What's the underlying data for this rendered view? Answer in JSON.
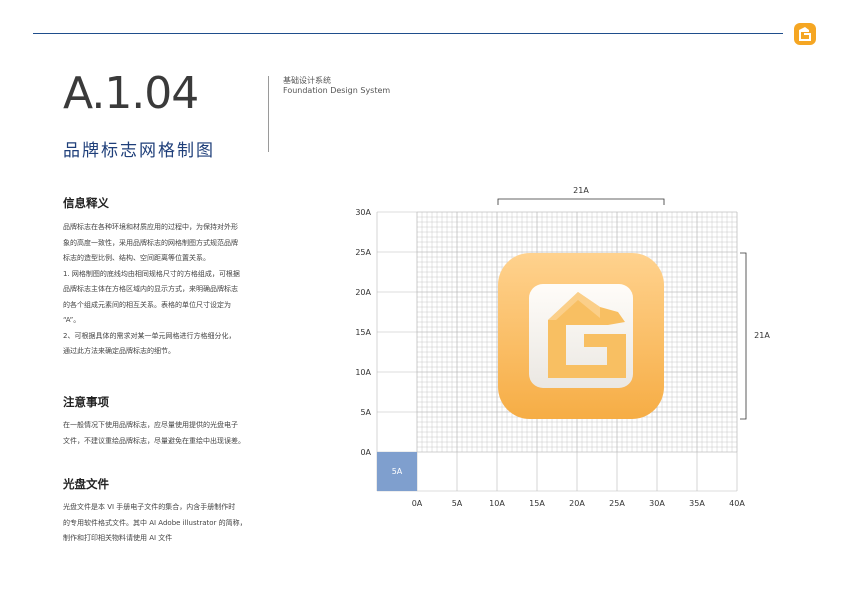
{
  "header": {
    "code": "A.1.04",
    "subtitle": "品牌标志网格制图",
    "system_cn": "基础设计系统",
    "system_en": "Foundation Design System"
  },
  "sections": [
    {
      "title": "信息释义",
      "lines": [
        "品牌标志在各种环境和材质应用的过程中，为保持对外形",
        "象的高度一致性，采用品牌标志的网格制图方式规范品牌",
        "标志的造型比例、结构、空间距离等位置关系。",
        "1. 网格制图的底线均由相同规格尺寸的方格组成，可根据",
        "品牌标志主体在方格区域内的显示方式，来明确品牌标志",
        "的各个组成元素间的相互关系。表格的单位尺寸设定为",
        "“A”。",
        "2、可根据具体的需求对某一单元网格进行方格细分化，",
        "通过此方法来确定品牌标志的细节。"
      ]
    },
    {
      "title": "注意事项",
      "lines": [
        "在一般情况下使用品牌标志，应尽量使用提供的光盘电子",
        "文件，不建议重绘品牌标志，尽量避免在重绘中出现误差。"
      ]
    },
    {
      "title": "光盘文件",
      "lines": [
        "光盘文件是本 VI 手册电子文件的集合，内含手册制作时",
        "的专用软件格式文件。其中 AI Adobe illustrator 的简称，",
        "制作和打印相关物料请使用 AI 文件"
      ]
    }
  ],
  "grid": {
    "y_labels": [
      "30A",
      "25A",
      "20A",
      "15A",
      "10A",
      "5A",
      "0A"
    ],
    "x_labels": [
      "0A",
      "5A",
      "10A",
      "15A",
      "20A",
      "25A",
      "30A",
      "35A",
      "40A"
    ],
    "unit_label": "5A",
    "top_dimension": "21A",
    "right_dimension": "21A"
  },
  "colors": {
    "accent_blue": "#1f3f7a",
    "unit_cell": "#7f9fce",
    "logo_top": "#ffd08a",
    "logo_bottom": "#f6b24d"
  }
}
